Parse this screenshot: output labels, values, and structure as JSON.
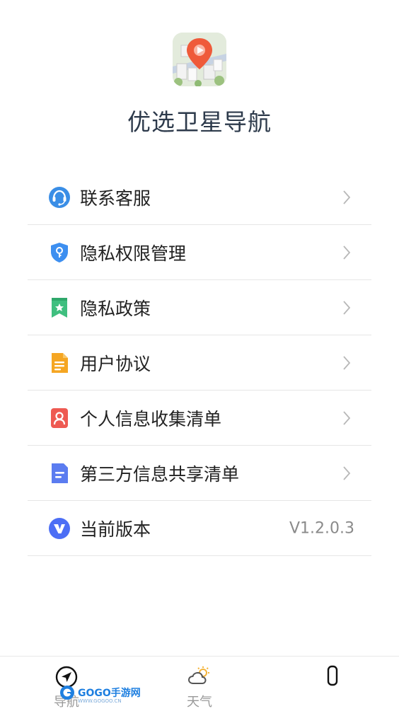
{
  "app": {
    "title": "优选卫星导航"
  },
  "menu": [
    {
      "label": "联系客服",
      "icon": "headset-icon",
      "value": ""
    },
    {
      "label": "隐私权限管理",
      "icon": "shield-key-icon",
      "value": ""
    },
    {
      "label": "隐私政策",
      "icon": "bookmark-star-icon",
      "value": ""
    },
    {
      "label": "用户协议",
      "icon": "document-icon",
      "value": ""
    },
    {
      "label": "个人信息收集清单",
      "icon": "person-card-icon",
      "value": ""
    },
    {
      "label": "第三方信息共享清单",
      "icon": "list-doc-icon",
      "value": ""
    },
    {
      "label": "当前版本",
      "icon": "v-logo-icon",
      "value": "V1.2.0.3"
    }
  ],
  "tabbar": {
    "items": [
      {
        "label": "导航",
        "icon": "compass-arrow-icon"
      },
      {
        "label": "天气",
        "icon": "weather-cloud-sun-icon"
      },
      {
        "label": "",
        "icon": "phone-outline-icon"
      }
    ]
  },
  "watermark": {
    "text": "GOGO手游网",
    "sub": "WWW.GOGOO.CN"
  },
  "colors": {
    "title": "#2d3a4b",
    "divider": "#e6e6e6",
    "version_text": "#8a8a8a",
    "headset": "#3a8ee6",
    "shield": "#3d8ff0",
    "bookmark": "#3fbf7f",
    "document": "#f5a623",
    "person_card": "#ee5a52",
    "list_doc": "#5b7cf0",
    "v_logo": "#4c6ef5"
  }
}
